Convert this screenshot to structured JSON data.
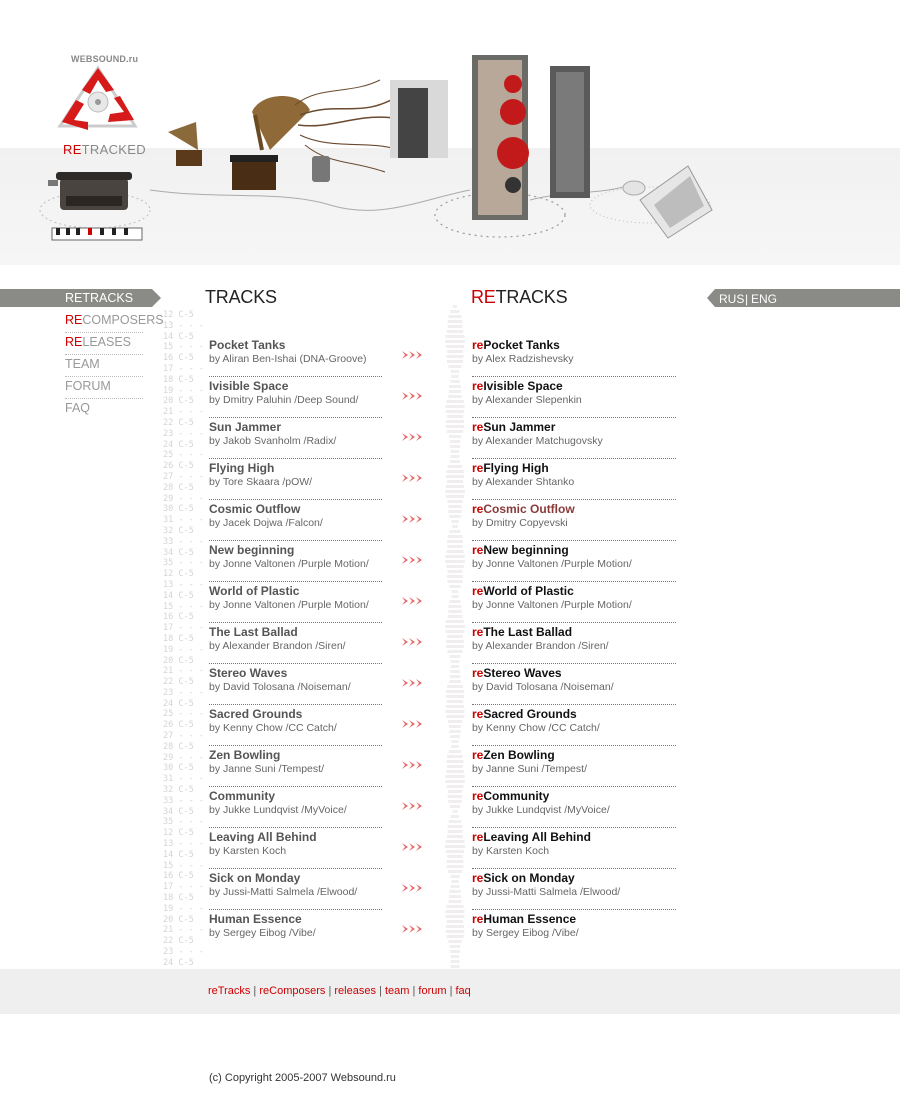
{
  "header": {
    "site_small": "WEBSOUND.ru",
    "logo_prefix": "RE",
    "logo_suffix": "TRACKED"
  },
  "nav": {
    "items": [
      {
        "prefix": "RE",
        "label": "TRACKS",
        "active": true
      },
      {
        "prefix": "RE",
        "label": "COMPOSERS"
      },
      {
        "prefix": "RE",
        "label": "LEASES"
      },
      {
        "prefix": "",
        "label": "TEAM"
      },
      {
        "prefix": "",
        "label": "FORUM"
      },
      {
        "prefix": "",
        "label": "FAQ"
      }
    ]
  },
  "left_column": {
    "title": "TRACKS",
    "tracks": [
      {
        "title": "Pocket Tanks",
        "by": "by Aliran Ben-Ishai (DNA-Groove)"
      },
      {
        "title": "Ivisible Space",
        "by": "by Dmitry Paluhin /Deep Sound/"
      },
      {
        "title": "Sun Jammer",
        "by": "by Jakob Svanholm /Radix/"
      },
      {
        "title": "Flying High",
        "by": "by Tore Skaara /pOW/"
      },
      {
        "title": "Cosmic Outflow",
        "by": "by Jacek Dojwa /Falcon/"
      },
      {
        "title": "New beginning",
        "by": "by Jonne Valtonen /Purple Motion/"
      },
      {
        "title": "World of Plastic",
        "by": "by Jonne Valtonen /Purple Motion/"
      },
      {
        "title": "The Last Ballad",
        "by": "by Alexander Brandon /Siren/"
      },
      {
        "title": "Stereo Waves",
        "by": "by David Tolosana /Noiseman/"
      },
      {
        "title": "Sacred Grounds",
        "by": "by Kenny Chow /CC Catch/"
      },
      {
        "title": "Zen Bowling",
        "by": "by Janne Suni /Tempest/"
      },
      {
        "title": "Community",
        "by": "by Jukke Lundqvist /MyVoice/"
      },
      {
        "title": "Leaving All Behind",
        "by": "by Karsten Koch"
      },
      {
        "title": "Sick on Monday",
        "by": "by Jussi-Matti Salmela /Elwood/"
      },
      {
        "title": "Human Essence",
        "by": "by Sergey Eibog /Vibe/"
      }
    ]
  },
  "right_column": {
    "title_prefix": "RE",
    "title": "TRACKS",
    "track_prefix": "re",
    "tracks": [
      {
        "title": "Pocket Tanks",
        "by": "by Alex Radzishevsky"
      },
      {
        "title": "Ivisible Space",
        "by": "by Alexander Slepenkin"
      },
      {
        "title": "Sun Jammer",
        "by": "by Alexander Matchugovsky"
      },
      {
        "title": "Flying High",
        "by": "by Alexander Shtanko"
      },
      {
        "title": "Cosmic Outflow",
        "by": "by Dmitry Copyevski",
        "highlight": true
      },
      {
        "title": "New beginning",
        "by": "by Jonne Valtonen /Purple Motion/"
      },
      {
        "title": "World of Plastic",
        "by": "by Jonne Valtonen /Purple Motion/"
      },
      {
        "title": "The Last Ballad",
        "by": "by Alexander Brandon /Siren/"
      },
      {
        "title": "Stereo Waves",
        "by": "by David Tolosana /Noiseman/"
      },
      {
        "title": "Sacred Grounds",
        "by": "by Kenny Chow /CC Catch/"
      },
      {
        "title": "Zen Bowling",
        "by": "by Janne Suni /Tempest/"
      },
      {
        "title": "Community",
        "by": "by Jukke Lundqvist /MyVoice/"
      },
      {
        "title": "Leaving All Behind",
        "by": "by Karsten Koch"
      },
      {
        "title": "Sick on Monday",
        "by": "by Jussi-Matti Salmela /Elwood/"
      },
      {
        "title": "Human Essence",
        "by": "by Sergey Eibog /Vibe/"
      }
    ]
  },
  "lang": {
    "rus": "RUS",
    "separator": "|",
    "eng": "ENG"
  },
  "footer": {
    "links": [
      "reTracks",
      "reComposers",
      "releases",
      "team",
      "forum",
      "faq"
    ],
    "separator": " | ",
    "copyright": "(c) Copyright 2005-2007 Websound.ru"
  },
  "colors": {
    "accent": "#cc0000",
    "nav_bar": "#8a8a86",
    "highlight_track": "#8b3a3a"
  }
}
